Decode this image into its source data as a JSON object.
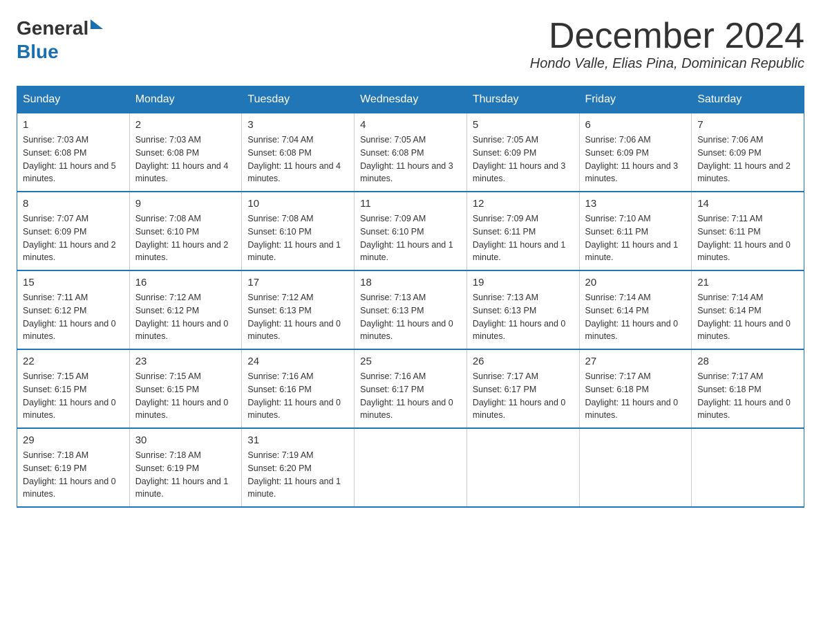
{
  "header": {
    "logo": {
      "general": "General",
      "arrow": "▶",
      "blue": "Blue"
    },
    "title": "December 2024",
    "subtitle": "Hondo Valle, Elias Pina, Dominican Republic"
  },
  "calendar": {
    "days_of_week": [
      "Sunday",
      "Monday",
      "Tuesday",
      "Wednesday",
      "Thursday",
      "Friday",
      "Saturday"
    ],
    "weeks": [
      [
        {
          "day": "1",
          "sunrise": "7:03 AM",
          "sunset": "6:08 PM",
          "daylight": "11 hours and 5 minutes."
        },
        {
          "day": "2",
          "sunrise": "7:03 AM",
          "sunset": "6:08 PM",
          "daylight": "11 hours and 4 minutes."
        },
        {
          "day": "3",
          "sunrise": "7:04 AM",
          "sunset": "6:08 PM",
          "daylight": "11 hours and 4 minutes."
        },
        {
          "day": "4",
          "sunrise": "7:05 AM",
          "sunset": "6:08 PM",
          "daylight": "11 hours and 3 minutes."
        },
        {
          "day": "5",
          "sunrise": "7:05 AM",
          "sunset": "6:09 PM",
          "daylight": "11 hours and 3 minutes."
        },
        {
          "day": "6",
          "sunrise": "7:06 AM",
          "sunset": "6:09 PM",
          "daylight": "11 hours and 3 minutes."
        },
        {
          "day": "7",
          "sunrise": "7:06 AM",
          "sunset": "6:09 PM",
          "daylight": "11 hours and 2 minutes."
        }
      ],
      [
        {
          "day": "8",
          "sunrise": "7:07 AM",
          "sunset": "6:09 PM",
          "daylight": "11 hours and 2 minutes."
        },
        {
          "day": "9",
          "sunrise": "7:08 AM",
          "sunset": "6:10 PM",
          "daylight": "11 hours and 2 minutes."
        },
        {
          "day": "10",
          "sunrise": "7:08 AM",
          "sunset": "6:10 PM",
          "daylight": "11 hours and 1 minute."
        },
        {
          "day": "11",
          "sunrise": "7:09 AM",
          "sunset": "6:10 PM",
          "daylight": "11 hours and 1 minute."
        },
        {
          "day": "12",
          "sunrise": "7:09 AM",
          "sunset": "6:11 PM",
          "daylight": "11 hours and 1 minute."
        },
        {
          "day": "13",
          "sunrise": "7:10 AM",
          "sunset": "6:11 PM",
          "daylight": "11 hours and 1 minute."
        },
        {
          "day": "14",
          "sunrise": "7:11 AM",
          "sunset": "6:11 PM",
          "daylight": "11 hours and 0 minutes."
        }
      ],
      [
        {
          "day": "15",
          "sunrise": "7:11 AM",
          "sunset": "6:12 PM",
          "daylight": "11 hours and 0 minutes."
        },
        {
          "day": "16",
          "sunrise": "7:12 AM",
          "sunset": "6:12 PM",
          "daylight": "11 hours and 0 minutes."
        },
        {
          "day": "17",
          "sunrise": "7:12 AM",
          "sunset": "6:13 PM",
          "daylight": "11 hours and 0 minutes."
        },
        {
          "day": "18",
          "sunrise": "7:13 AM",
          "sunset": "6:13 PM",
          "daylight": "11 hours and 0 minutes."
        },
        {
          "day": "19",
          "sunrise": "7:13 AM",
          "sunset": "6:13 PM",
          "daylight": "11 hours and 0 minutes."
        },
        {
          "day": "20",
          "sunrise": "7:14 AM",
          "sunset": "6:14 PM",
          "daylight": "11 hours and 0 minutes."
        },
        {
          "day": "21",
          "sunrise": "7:14 AM",
          "sunset": "6:14 PM",
          "daylight": "11 hours and 0 minutes."
        }
      ],
      [
        {
          "day": "22",
          "sunrise": "7:15 AM",
          "sunset": "6:15 PM",
          "daylight": "11 hours and 0 minutes."
        },
        {
          "day": "23",
          "sunrise": "7:15 AM",
          "sunset": "6:15 PM",
          "daylight": "11 hours and 0 minutes."
        },
        {
          "day": "24",
          "sunrise": "7:16 AM",
          "sunset": "6:16 PM",
          "daylight": "11 hours and 0 minutes."
        },
        {
          "day": "25",
          "sunrise": "7:16 AM",
          "sunset": "6:17 PM",
          "daylight": "11 hours and 0 minutes."
        },
        {
          "day": "26",
          "sunrise": "7:17 AM",
          "sunset": "6:17 PM",
          "daylight": "11 hours and 0 minutes."
        },
        {
          "day": "27",
          "sunrise": "7:17 AM",
          "sunset": "6:18 PM",
          "daylight": "11 hours and 0 minutes."
        },
        {
          "day": "28",
          "sunrise": "7:17 AM",
          "sunset": "6:18 PM",
          "daylight": "11 hours and 0 minutes."
        }
      ],
      [
        {
          "day": "29",
          "sunrise": "7:18 AM",
          "sunset": "6:19 PM",
          "daylight": "11 hours and 0 minutes."
        },
        {
          "day": "30",
          "sunrise": "7:18 AM",
          "sunset": "6:19 PM",
          "daylight": "11 hours and 1 minute."
        },
        {
          "day": "31",
          "sunrise": "7:19 AM",
          "sunset": "6:20 PM",
          "daylight": "11 hours and 1 minute."
        },
        null,
        null,
        null,
        null
      ]
    ]
  }
}
